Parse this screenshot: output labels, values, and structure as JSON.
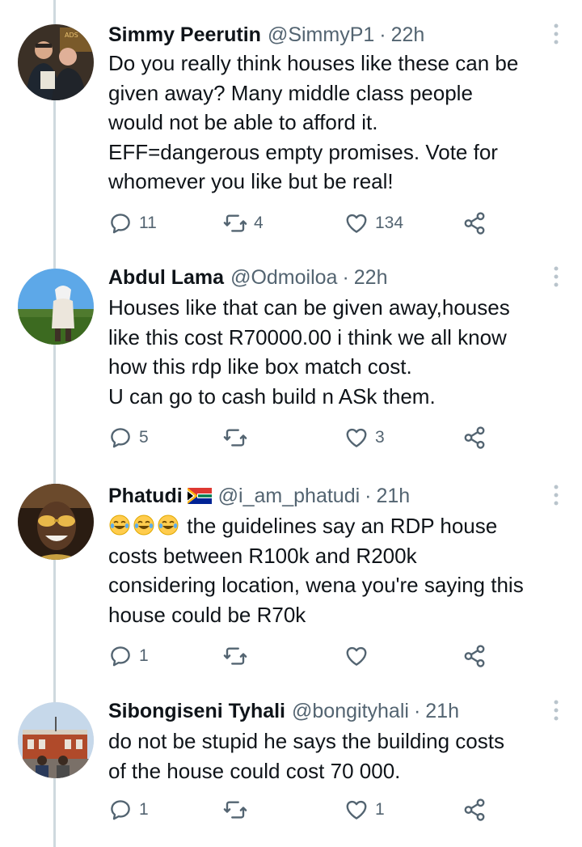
{
  "tweets": [
    {
      "display_name": "Simmy Peerutin",
      "handle": "@SimmyP1",
      "separator": "·",
      "time": "22h",
      "text": "Do you really think houses like these can be\ngiven away? Many middle class people\nwould not be able to afford it.\nEFF=dangerous empty promises. Vote for\nwhomever you like but be real!",
      "replies": "11",
      "retweets": "4",
      "likes": "134"
    },
    {
      "display_name": "Abdul Lama",
      "handle": "@Odmoiloa",
      "separator": "·",
      "time": "22h",
      "text": "Houses like that can be given away,houses\nlike this cost R70000.00 i think we all know\nhow this rdp like box match cost.\nU can go to cash build n ASk them.",
      "replies": "5",
      "retweets": "",
      "likes": "3"
    },
    {
      "display_name": "Phatudi",
      "flag": "south-africa-flag",
      "handle": "@i_am_phatudi",
      "separator": "·",
      "time": "21h",
      "emoji": "tears-of-joy-emoji",
      "text": "the guidelines say an RDP house\ncosts between R100k and R200k\nconsidering location, wena you're saying this\nhouse could be R70k",
      "replies": "1",
      "retweets": "",
      "likes": ""
    },
    {
      "display_name": "Sibongiseni Tyhali",
      "handle": "@bongityhali",
      "separator": "·",
      "time": "21h",
      "text": "do not be stupid he says the building costs\nof the house could cost 70 000.",
      "replies": "1",
      "retweets": "",
      "likes": "1"
    }
  ],
  "icons": {
    "reply": "reply-icon",
    "retweet": "retweet-icon",
    "like": "heart-icon",
    "share": "share-icon",
    "more": "more-icon"
  },
  "colors": {
    "text": "#0f1419",
    "secondary": "#536471",
    "thread_line": "#cfd9de"
  }
}
